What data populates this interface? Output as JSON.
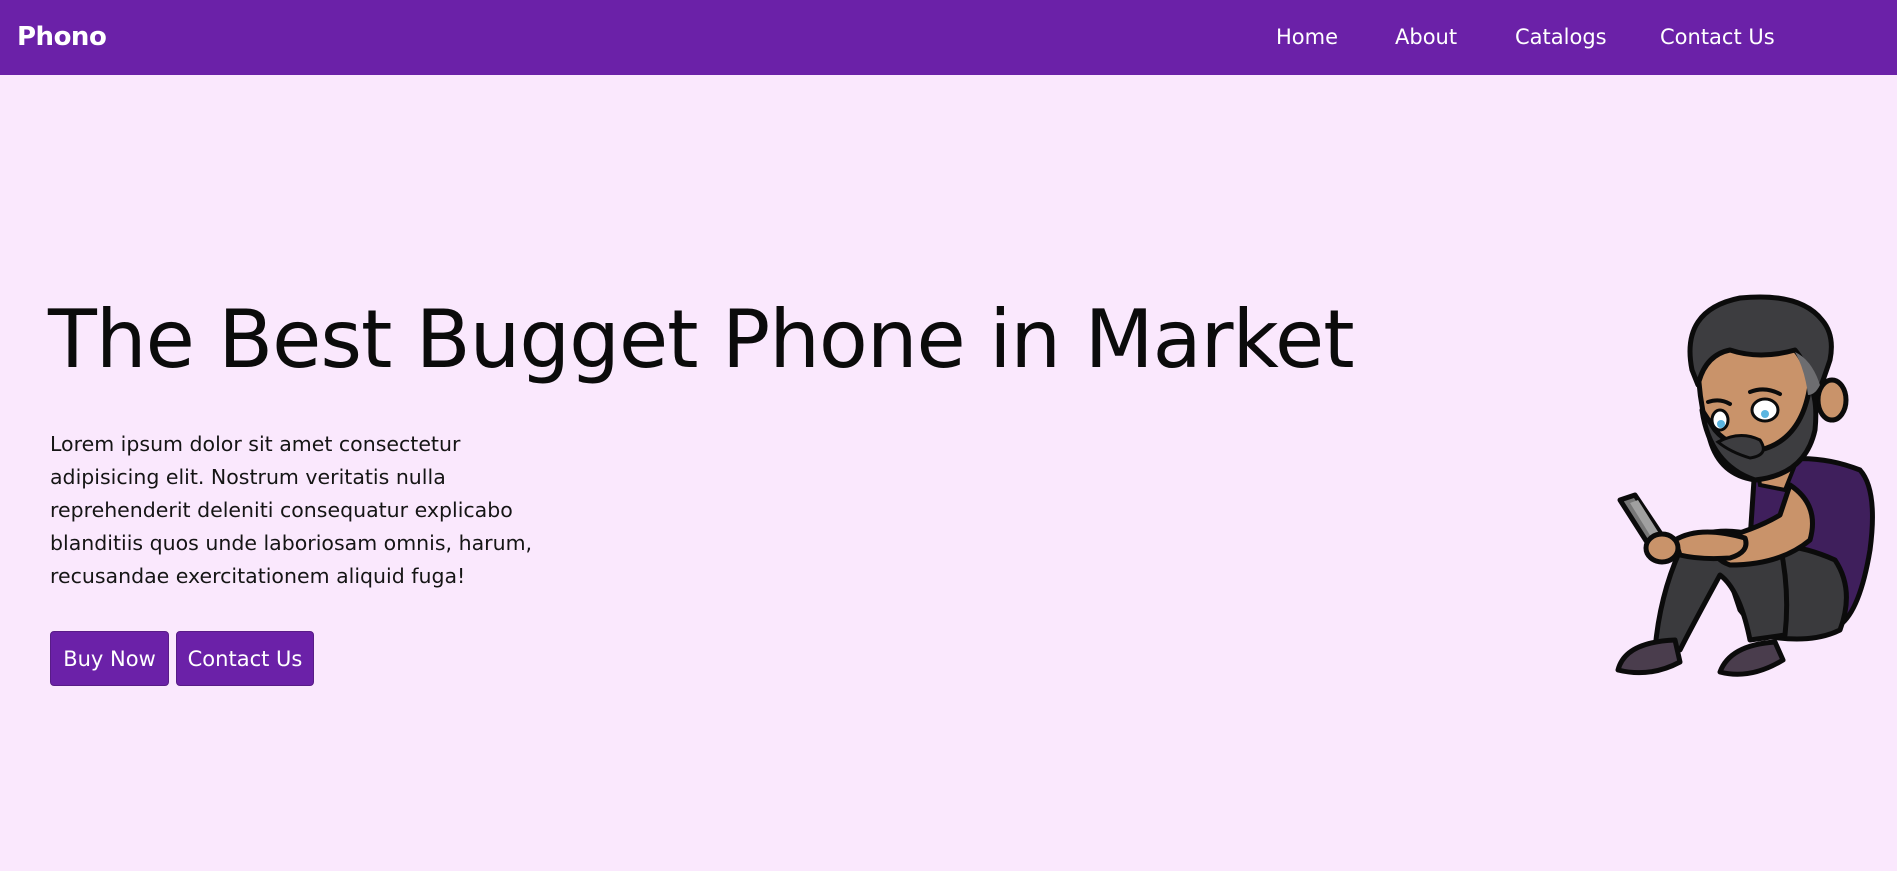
{
  "nav": {
    "brand": "Phono",
    "links": [
      "Home",
      "About",
      "Catalogs",
      "Contact Us"
    ]
  },
  "hero": {
    "title": "The Best Bugget Phone in Market",
    "description": "Lorem ipsum dolor sit amet consectetur adipisicing elit. Nostrum veritatis nulla reprehenderit deleniti consequatur explicabo blanditiis quos unde laboriosam omnis, harum, recusandae exercitationem aliquid fuga!",
    "buttons": {
      "primary": "Buy Now",
      "secondary": "Contact Us"
    }
  },
  "colors": {
    "brand": "#6b21a8",
    "background": "#fae8fd",
    "text": "#0b0b0b"
  },
  "illustration": {
    "icon": "man-sitting-with-phone-illustration"
  }
}
